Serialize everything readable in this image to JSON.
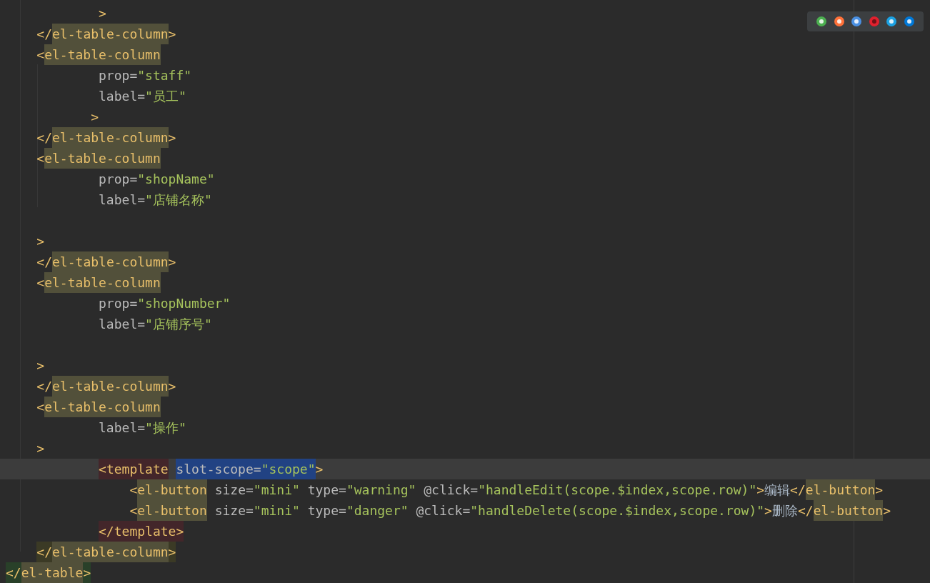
{
  "editor": {
    "lines": [
      {
        "current": false,
        "kind": "inner",
        "tokens": [
          {
            "kind": "punct",
            "text": ">"
          }
        ]
      },
      {
        "current": false,
        "kind": "outer",
        "tokens": [
          {
            "kind": "punct",
            "text": "</"
          },
          {
            "kind": "tag",
            "text": "el-table-column",
            "color": "#52503a"
          },
          {
            "kind": "punct",
            "text": ">"
          }
        ]
      },
      {
        "current": false,
        "kind": "outer",
        "tokens": [
          {
            "kind": "punct",
            "text": "<"
          },
          {
            "kind": "tag",
            "text": "el-table-column",
            "color": "#52503a"
          }
        ]
      },
      {
        "current": false,
        "kind": "inner",
        "tokens": [
          {
            "kind": "attr",
            "text": "prop="
          },
          {
            "kind": "string",
            "text": "\"staff\""
          }
        ]
      },
      {
        "current": false,
        "kind": "inner",
        "tokens": [
          {
            "kind": "attr",
            "text": "label="
          },
          {
            "kind": "string",
            "text": "\"员工\""
          }
        ]
      },
      {
        "current": false,
        "kind": "stray",
        "tokens": [
          {
            "kind": "punct",
            "text": ">"
          }
        ]
      },
      {
        "current": false,
        "kind": "outer",
        "tokens": [
          {
            "kind": "punct",
            "text": "</"
          },
          {
            "kind": "tag",
            "text": "el-table-column",
            "color": "#52503a"
          },
          {
            "kind": "punct",
            "text": ">"
          }
        ]
      },
      {
        "current": false,
        "kind": "outer",
        "tokens": [
          {
            "kind": "punct",
            "text": "<"
          },
          {
            "kind": "tag",
            "text": "el-table-column",
            "color": "#52503a"
          }
        ]
      },
      {
        "current": false,
        "kind": "inner",
        "tokens": [
          {
            "kind": "attr",
            "text": "prop="
          },
          {
            "kind": "string",
            "text": "\"shopName\""
          }
        ]
      },
      {
        "current": false,
        "kind": "inner",
        "tokens": [
          {
            "kind": "attr",
            "text": "label="
          },
          {
            "kind": "string",
            "text": "\"店铺名称\""
          }
        ]
      },
      {
        "current": false,
        "kind": "blank"
      },
      {
        "current": false,
        "kind": "outer",
        "tokens": [
          {
            "kind": "punct",
            "text": ">"
          }
        ]
      },
      {
        "current": false,
        "kind": "outer",
        "tokens": [
          {
            "kind": "punct",
            "text": "</"
          },
          {
            "kind": "tag",
            "text": "el-table-column",
            "color": "#52503a"
          },
          {
            "kind": "punct",
            "text": ">"
          }
        ]
      },
      {
        "current": false,
        "kind": "outer",
        "tokens": [
          {
            "kind": "punct",
            "text": "<"
          },
          {
            "kind": "tag",
            "text": "el-table-column",
            "color": "#52503a"
          }
        ]
      },
      {
        "current": false,
        "kind": "inner",
        "tokens": [
          {
            "kind": "attr",
            "text": "prop="
          },
          {
            "kind": "string",
            "text": "\"shopNumber\""
          }
        ]
      },
      {
        "current": false,
        "kind": "inner",
        "tokens": [
          {
            "kind": "attr",
            "text": "label="
          },
          {
            "kind": "string",
            "text": "\"店铺序号\""
          }
        ]
      },
      {
        "current": false,
        "kind": "blank"
      },
      {
        "current": false,
        "kind": "outer",
        "tokens": [
          {
            "kind": "punct",
            "text": ">"
          }
        ]
      },
      {
        "current": false,
        "kind": "outer",
        "tokens": [
          {
            "kind": "punct",
            "text": "</"
          },
          {
            "kind": "tag",
            "text": "el-table-column",
            "color": "#52503a"
          },
          {
            "kind": "punct",
            "text": ">"
          }
        ]
      },
      {
        "current": false,
        "kind": "outer",
        "tokens": [
          {
            "kind": "punct",
            "text": "<"
          },
          {
            "kind": "tag",
            "text": "el-table-column",
            "color": "#52503a"
          }
        ]
      },
      {
        "current": false,
        "kind": "inner",
        "tokens": [
          {
            "kind": "attr",
            "text": "label="
          },
          {
            "kind": "string",
            "text": "\"操作\""
          }
        ]
      },
      {
        "current": false,
        "kind": "outer",
        "tokens": [
          {
            "kind": "punct",
            "text": ">"
          }
        ]
      },
      {
        "current": true,
        "kind": "inner",
        "tokens": [
          {
            "kind": "punct",
            "text": "<",
            "color": "#43262a"
          },
          {
            "kind": "tag",
            "text": "template",
            "color": "#43262a"
          },
          {
            "kind": "attr",
            "text": "slot-scope=",
            "color": "#214283"
          },
          {
            "kind": "string",
            "text": "\"scope\"",
            "color": "#214283"
          },
          {
            "kind": "punct",
            "text": ">"
          }
        ]
      },
      {
        "current": false,
        "kind": "deep",
        "tokens": [
          {
            "kind": "punct",
            "text": "<"
          },
          {
            "kind": "tag",
            "text": "el-button",
            "color": "#52503a"
          },
          {
            "kind": "attr",
            "text": "size="
          },
          {
            "kind": "string",
            "text": "\"mini\""
          },
          {
            "kind": "attr",
            "text": "type="
          },
          {
            "kind": "string",
            "text": "\"warning\""
          },
          {
            "kind": "attr",
            "text": "@click="
          },
          {
            "kind": "string",
            "text": "\"handleEdit(scope.$index,scope.row)\""
          },
          {
            "kind": "punct",
            "text": ">"
          },
          {
            "kind": "text",
            "text": "编辑"
          },
          {
            "kind": "punct",
            "text": "</"
          },
          {
            "kind": "tag",
            "text": "el-button",
            "color": "#52503a"
          },
          {
            "kind": "punct",
            "text": ">"
          }
        ]
      },
      {
        "current": false,
        "kind": "deep",
        "tokens": [
          {
            "kind": "punct",
            "text": "<"
          },
          {
            "kind": "tag",
            "text": "el-button",
            "color": "#52503a"
          },
          {
            "kind": "attr",
            "text": "size="
          },
          {
            "kind": "string",
            "text": "\"mini\""
          },
          {
            "kind": "attr",
            "text": "type="
          },
          {
            "kind": "string",
            "text": "\"danger\""
          },
          {
            "kind": "attr",
            "text": "@click="
          },
          {
            "kind": "string",
            "text": "\"handleDelete(scope.$index,scope.row)\""
          },
          {
            "kind": "punct",
            "text": ">"
          },
          {
            "kind": "text",
            "text": "删除"
          },
          {
            "kind": "punct",
            "text": "</"
          },
          {
            "kind": "tag",
            "text": "el-button",
            "color": "#52503a"
          },
          {
            "kind": "punct",
            "text": ">"
          }
        ]
      },
      {
        "current": false,
        "kind": "inner",
        "tokens": [
          {
            "kind": "punct",
            "text": "</",
            "color": "#43262a"
          },
          {
            "kind": "tag",
            "text": "template",
            "color": "#43262a"
          },
          {
            "kind": "punct",
            "text": ">",
            "color": "#43262a"
          }
        ]
      },
      {
        "current": false,
        "kind": "outer",
        "tokens": [
          {
            "kind": "punct",
            "text": "</",
            "color": "#3b3a25"
          },
          {
            "kind": "tag",
            "text": "el-table-column",
            "color": "#52503a"
          },
          {
            "kind": "punct",
            "text": ">",
            "color": "#3b3a25"
          }
        ]
      },
      {
        "current": false,
        "kind": "root",
        "tokens": [
          {
            "kind": "punct",
            "text": "</",
            "color": "#294029"
          },
          {
            "kind": "tag",
            "text": "el-table",
            "color": "#52503a"
          },
          {
            "kind": "punct",
            "text": ">",
            "color": "#294029"
          }
        ]
      }
    ]
  }
}
